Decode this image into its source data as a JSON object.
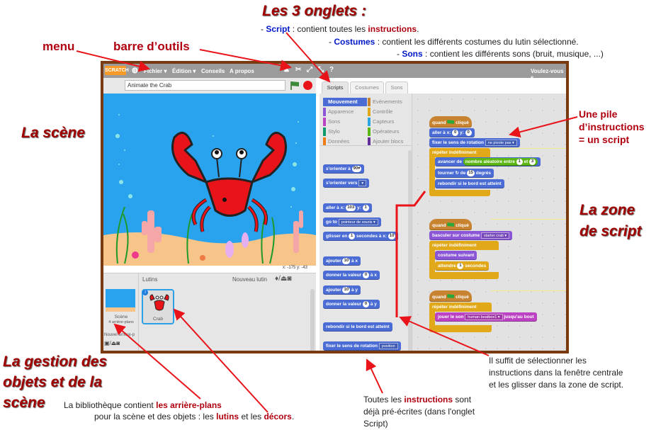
{
  "annotations": {
    "tabs_title": "Les 3 onglets :",
    "tabs_lines": [
      {
        "dash": "- ",
        "key": "Script",
        "text": " : contient toutes les ",
        "em": "instructions",
        "end": "."
      },
      {
        "dash": "- ",
        "key": "Costumes",
        "text": " : contient les différents costumes du lutin sélectionné.",
        "em": "",
        "end": ""
      },
      {
        "dash": "- ",
        "key": "Sons",
        "text": " : contient les différents sons (bruit, musique, ...)",
        "em": "",
        "end": ""
      }
    ],
    "menu_label": "menu",
    "toolbar_label": "barre d’outils",
    "stage_label": "La scène",
    "script_pile": [
      "Une pile",
      "d’instructions",
      "= un script"
    ],
    "script_zone": [
      "La zone",
      "de script"
    ],
    "objects_title": [
      "La gestion des",
      "objets et de la",
      "scène"
    ],
    "library_line1": {
      "text": "La bibliothèque  contient ",
      "em": "les arrière-plans"
    },
    "library_line2": {
      "a": "pour la scène  et des objets : les ",
      "em1": "lutins",
      "b": " et les ",
      "em2": "décors",
      "c": "."
    },
    "drag_note": [
      "Il suffit de sélectionner les",
      "instructions dans la fenêtre centrale",
      "et les glisser dans la zone de script."
    ],
    "prewritten_note": {
      "a": "Toutes les ",
      "em": "instructions",
      "b": " sont",
      "line2": "déjà pré-écrites (dans l'onglet",
      "line3": "Script)"
    }
  },
  "app": {
    "logo": "SCRATCH",
    "menu": [
      "Fichier ▾",
      "Édition ▾",
      "Conseils",
      "A propos"
    ],
    "toolbar_icons": [
      "duplicate-icon",
      "delete-icon",
      "grow-icon",
      "shrink-icon",
      "help-icon"
    ],
    "right_text": "Voulez-vous s",
    "project_title": "Animate the Crab",
    "coords": "x: -175  y: -43",
    "tabs": [
      "Scripts",
      "Costumes",
      "Sons"
    ],
    "categories_left": [
      "Mouvement",
      "Apparence",
      "Sons",
      "Stylo",
      "Données"
    ],
    "categories_right": [
      "Evènements",
      "Contrôle",
      "Capteurs",
      "Opérateurs",
      "Ajouter blocs"
    ],
    "category_colors": {
      "Mouvement": "#4a6cd4",
      "Apparence": "#8a55d7",
      "Sons": "#bb42c3",
      "Stylo": "#0e9a6c",
      "Données": "#ee7d16",
      "Evènements": "#c88330",
      "Contrôle": "#e1a91a",
      "Capteurs": "#2ca5e2",
      "Opérateurs": "#5cb712",
      "Ajouter blocs": "#632d99"
    },
    "sprites_header": "Lutins",
    "new_sprite": "Nouveau lutin",
    "stage_thumb": {
      "name": "Scène",
      "sub": "4 arrière-plans",
      "new_backdrop": "Nouvel arrière-p"
    },
    "sprite": {
      "name": "Crab"
    }
  },
  "palette_blocks": {
    "point_dir": {
      "text": "s'orienter à",
      "val": "90▾"
    },
    "point_towards": {
      "text": "s'orienter vers",
      "val": "▾"
    },
    "goto_xy": {
      "a": "aller à x:",
      "x": "103",
      "b": "y:",
      "y": "1"
    },
    "goto": {
      "a": "go to",
      "val": "pointeur de souris ▾"
    },
    "glide": {
      "a": "glisser en",
      "n": "1",
      "b": "secondes à x:",
      "x": "10"
    },
    "change_x": {
      "a": "ajouter",
      "n": "10",
      "b": "à x"
    },
    "set_x": {
      "a": "donner la valeur",
      "n": "0",
      "b": "à x"
    },
    "change_y": {
      "a": "ajouter",
      "n": "10",
      "b": "à y"
    },
    "set_y": {
      "a": "donner la valeur",
      "n": "0",
      "b": "à y"
    },
    "bounce": "rebondir si le bord est atteint",
    "rotation": {
      "a": "fixer le sens de rotation",
      "val": "position"
    }
  },
  "scripts": [
    {
      "hat": {
        "a": "quand",
        "b": "cliqué"
      },
      "goto": {
        "a": "aller à x:",
        "x": "0",
        "b": "y:",
        "y": "0"
      },
      "rotation": {
        "a": "fixer le sens de rotation",
        "val": "ne pivote pas ▾"
      },
      "forever": "répéter indéfiniment",
      "move": {
        "a": "avancer de",
        "op": "nombre aléatoire entre",
        "n1": "1",
        "et": "et",
        "n2": "3"
      },
      "turn": {
        "a": "tourner ↻ de",
        "n": "15",
        "b": "degrés"
      },
      "bounce": "rebondir si le bord est atteint"
    },
    {
      "hat": {
        "a": "quand",
        "b": "cliqué"
      },
      "switch": {
        "a": "basculer sur costume",
        "val": "starter crab ▾"
      },
      "forever": "répéter indéfiniment",
      "next": "costume suivant",
      "wait": {
        "a": "attendre",
        "n": "1",
        "b": "secondes"
      }
    },
    {
      "hat": {
        "a": "quand",
        "b": "cliqué"
      },
      "forever": "répéter indéfiniment",
      "play": {
        "a": "jouer le son",
        "val": "human beatbox1 ▾",
        "b": "jusqu'au bout"
      }
    }
  ]
}
